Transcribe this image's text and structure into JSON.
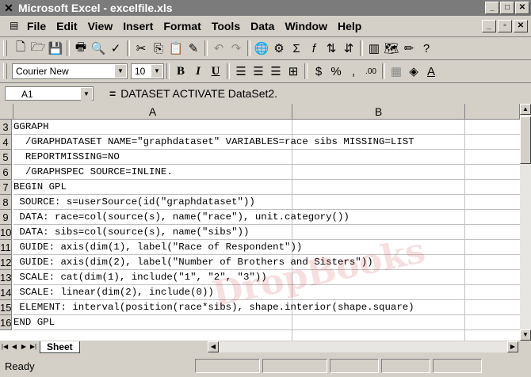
{
  "window": {
    "title": "Microsoft Excel - excelfile.xls"
  },
  "menu": {
    "items": [
      "File",
      "Edit",
      "View",
      "Insert",
      "Format",
      "Tools",
      "Data",
      "Window",
      "Help"
    ]
  },
  "format_toolbar": {
    "font": "Courier New",
    "size": "10"
  },
  "formula_bar": {
    "cell_ref": "A1",
    "eq": "=",
    "content": "DATASET ACTIVATE DataSet2."
  },
  "columns": [
    "A",
    "B"
  ],
  "rows": [
    {
      "num": "3",
      "text": "GGRAPH"
    },
    {
      "num": "4",
      "text": "  /GRAPHDATASET NAME=\"graphdataset\" VARIABLES=race sibs MISSING=LIST"
    },
    {
      "num": "5",
      "text": "  REPORTMISSING=NO"
    },
    {
      "num": "6",
      "text": "  /GRAPHSPEC SOURCE=INLINE."
    },
    {
      "num": "7",
      "text": "BEGIN GPL"
    },
    {
      "num": "8",
      "text": " SOURCE: s=userSource(id(\"graphdataset\"))"
    },
    {
      "num": "9",
      "text": " DATA: race=col(source(s), name(\"race\"), unit.category())"
    },
    {
      "num": "10",
      "text": " DATA: sibs=col(source(s), name(\"sibs\"))"
    },
    {
      "num": "11",
      "text": " GUIDE: axis(dim(1), label(\"Race of Respondent\"))"
    },
    {
      "num": "12",
      "text": " GUIDE: axis(dim(2), label(\"Number of Brothers and Sisters\"))"
    },
    {
      "num": "13",
      "text": " SCALE: cat(dim(1), include(\"1\", \"2\", \"3\"))"
    },
    {
      "num": "14",
      "text": " SCALE: linear(dim(2), include(0))"
    },
    {
      "num": "15",
      "text": " ELEMENT: interval(position(race*sibs), shape.interior(shape.square)"
    },
    {
      "num": "16",
      "text": "END GPL"
    }
  ],
  "sheet_tab": "Sheet",
  "status": {
    "text": "Ready"
  },
  "watermark": "DropBooks",
  "colors": {
    "titlebar": "#7b7b7b",
    "chrome": "#d4d0c8",
    "watermark": "#c00000"
  }
}
